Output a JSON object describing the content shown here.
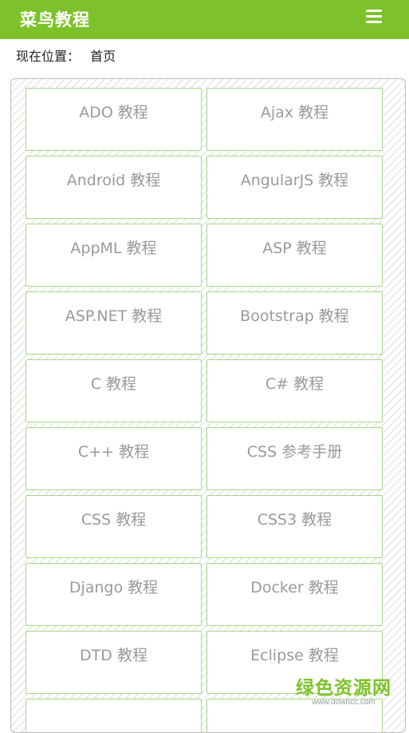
{
  "header": {
    "title": "菜鸟教程",
    "menu_icon": "hamburger-menu-icon",
    "color": "#7ec22b"
  },
  "breadcrumb": {
    "label": "现在位置：",
    "current": "首页"
  },
  "courses": [
    "ADO 教程",
    "Ajax 教程",
    "Android 教程",
    "AngularJS 教程",
    "AppML 教程",
    "ASP 教程",
    "ASP.NET 教程",
    "Bootstrap 教程",
    "C 教程",
    "C# 教程",
    "C++ 教程",
    "CSS 参考手册",
    "CSS 教程",
    "CSS3 教程",
    "Django 教程",
    "Docker 教程",
    "DTD 教程",
    "Eclipse 教程",
    "",
    ""
  ],
  "watermark": {
    "main": "绿色资源网",
    "sub": "www.downcc.com"
  }
}
